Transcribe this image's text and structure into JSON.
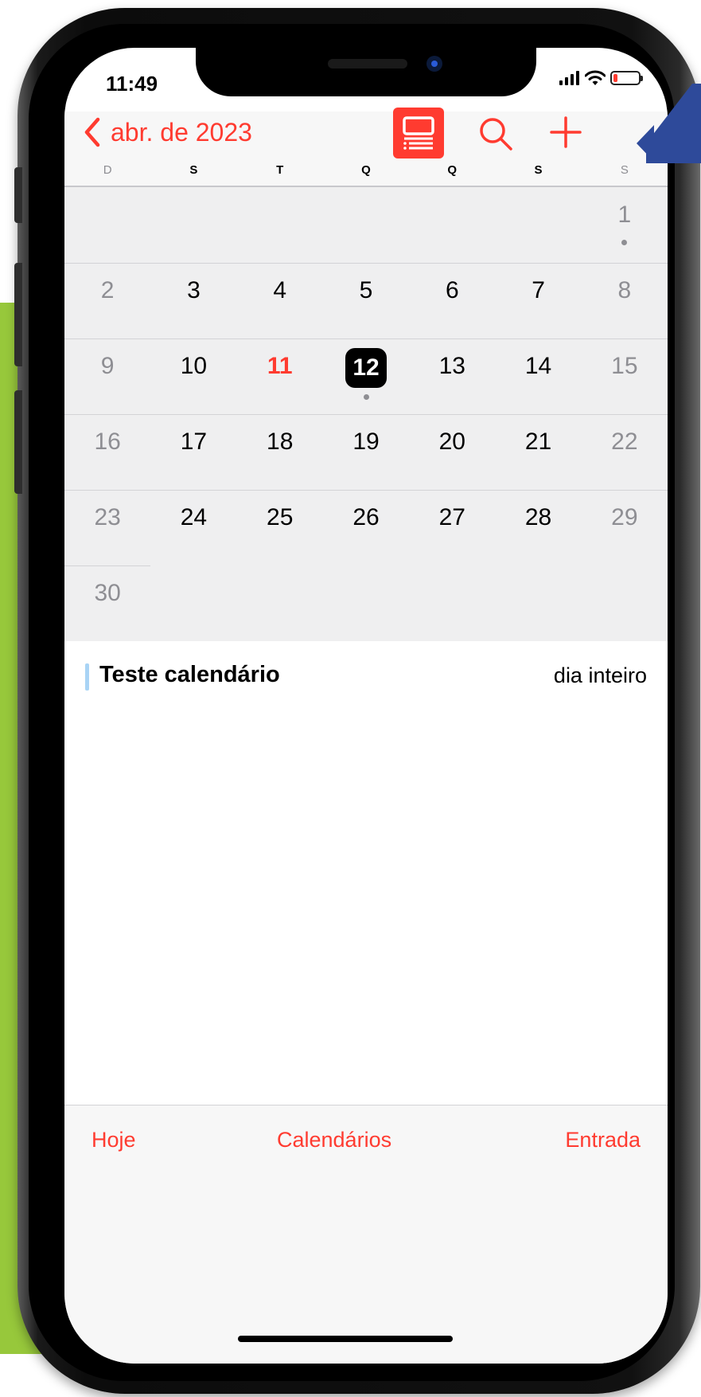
{
  "status_bar": {
    "time": "11:49"
  },
  "header": {
    "month_label": "abr. de 2023"
  },
  "weekdays": [
    "D",
    "S",
    "T",
    "Q",
    "Q",
    "S",
    "S"
  ],
  "calendar": {
    "weeks": [
      [
        "",
        "",
        "",
        "",
        "",
        "",
        "1"
      ],
      [
        "2",
        "3",
        "4",
        "5",
        "6",
        "7",
        "8"
      ],
      [
        "9",
        "10",
        "11",
        "12",
        "13",
        "14",
        "15"
      ],
      [
        "16",
        "17",
        "18",
        "19",
        "20",
        "21",
        "22"
      ],
      [
        "23",
        "24",
        "25",
        "26",
        "27",
        "28",
        "29"
      ],
      [
        "30",
        "",
        "",
        "",
        "",
        "",
        ""
      ]
    ],
    "today": "11",
    "selected": "12"
  },
  "event": {
    "title": "Teste calendário",
    "time": "dia inteiro"
  },
  "toolbar": {
    "today_label": "Hoje",
    "calendars_label": "Calendários",
    "inbox_label": "Entrada"
  },
  "colors": {
    "accent": "#ff3b30",
    "event_bar": "#a9d4f5",
    "background_band": "#97c83b",
    "callout_arrow": "#2e4a9a"
  }
}
